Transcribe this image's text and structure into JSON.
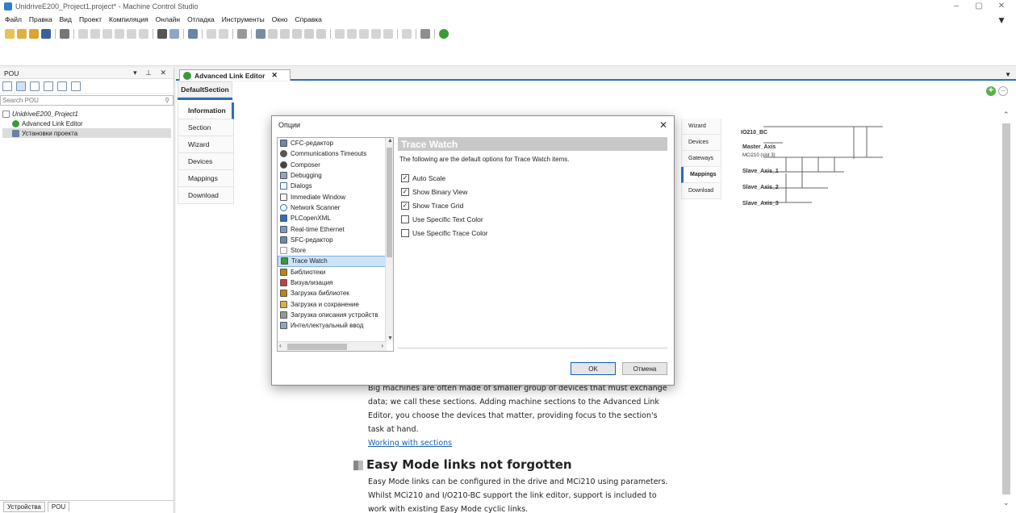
{
  "window": {
    "title": "UnidriveE200_Project1.project* - Machine Control Studio",
    "min": "–",
    "max": "▢",
    "close": "✕"
  },
  "menu": [
    "Файл",
    "Правка",
    "Вид",
    "Проект",
    "Компиляция",
    "Онлайн",
    "Отладка",
    "Инструменты",
    "Окно",
    "Справка"
  ],
  "pou_panel": {
    "title": "POU",
    "controls": "▾ ⊥ ✕",
    "search_placeholder": "Search POU",
    "tree": {
      "project": "UnidriveE200_Project1",
      "items": [
        "Advanced Link Editor",
        "Установки проекта"
      ]
    },
    "bottom_tabs": [
      "Устройства",
      "POU"
    ]
  },
  "editor": {
    "tab_label": "Advanced Link Editor",
    "tab_close": "✕",
    "section_tab": "DefaultSection",
    "info_tabs": [
      "Information",
      "Section",
      "Wizard",
      "Devices",
      "Mappings",
      "Download"
    ],
    "mini_tabs": [
      "Wizard",
      "Devices",
      "Gateways",
      "Mappings",
      "Download"
    ],
    "diagram_labels": [
      "IO210_BC",
      "Master_Axis",
      "MCi210 (slot 3)",
      "Slave_Axis_1",
      "Slave_Axis_2",
      "Slave_Axis_3"
    ],
    "content": {
      "para1": "Big machines are often made of smaller group of devices that must exchange data; we call these sections. Adding machine sections to the Advanced Link Editor, you choose the devices that matter, providing focus to the section's task at hand.",
      "link1": "Working with sections",
      "heading2": "Easy Mode links not forgotten",
      "para2": "Easy Mode links can be configured in the drive and MCi210 using parameters. Whilst MCi210 and I/O210-BC support the link editor, support is included to work with existing Easy Mode cyclic links."
    }
  },
  "dialog": {
    "title": "Опции",
    "close": "✕",
    "list_items": [
      "CFC-редактор",
      "Communications Timeouts",
      "Composer",
      "Debugging",
      "Dialogs",
      "Immediate Window",
      "Network Scanner",
      "PLCopenXML",
      "Real-time Ethernet",
      "SFC-редактор",
      "Store",
      "Trace Watch",
      "Библиотеки",
      "Визуализация",
      "Загрузка библиотек",
      "Загрузка и сохранение",
      "Загрузка описания устройств",
      "Интеллектуальный ввод"
    ],
    "selected_item": "Trace Watch",
    "panel_title": "Trace Watch",
    "panel_desc": "The following are the default options for Trace Watch items.",
    "options": [
      {
        "label": "Auto Scale",
        "checked": true
      },
      {
        "label": "Show Binary View",
        "checked": true
      },
      {
        "label": "Show Trace Grid",
        "checked": true
      },
      {
        "label": "Use Specific Text Color",
        "checked": false
      },
      {
        "label": "Use Specific Trace Color",
        "checked": false
      }
    ],
    "ok": "OK",
    "cancel": "Отмена"
  },
  "colors": {
    "accent": "#2b6fb9",
    "selection": "#cde3f7",
    "panel_header": "#c8c8c8",
    "link": "#1a5fb4"
  }
}
